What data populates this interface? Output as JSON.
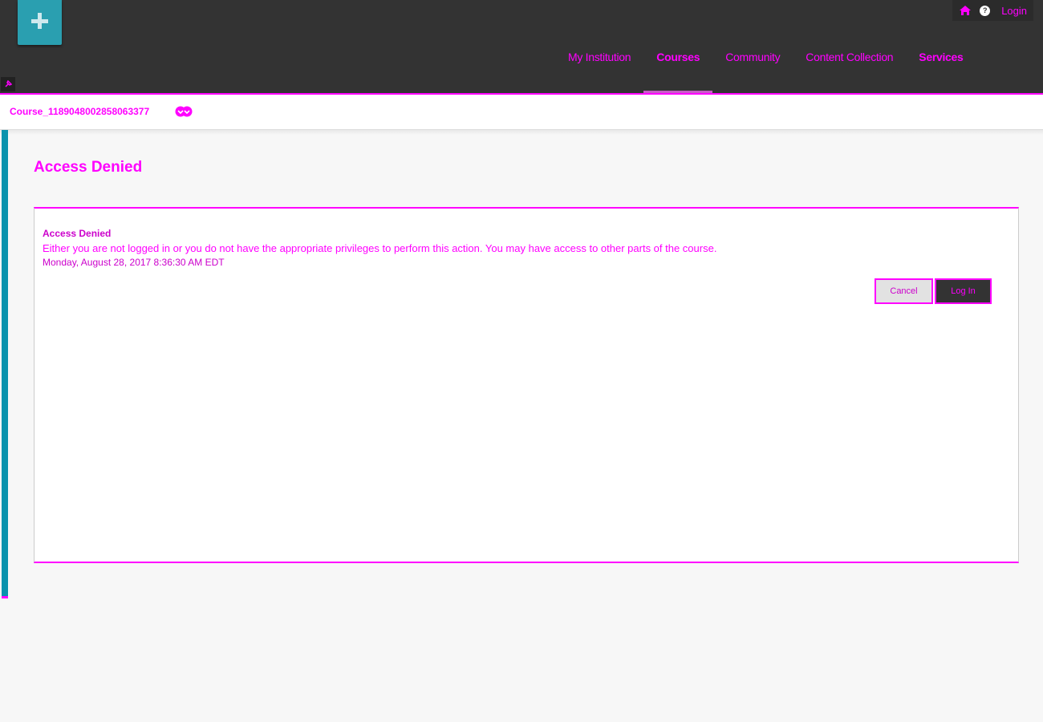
{
  "header": {
    "logo_icon": "plus-icon",
    "utility": {
      "home_icon": "home-icon",
      "help_icon": "help-icon",
      "help_glyph": "?",
      "login_label": "Login"
    },
    "nav": [
      {
        "label": "My Institution",
        "active": false
      },
      {
        "label": "Courses",
        "active": true
      },
      {
        "label": "Community",
        "active": false
      },
      {
        "label": "Content Collection",
        "active": false
      },
      {
        "label": "Services",
        "active": false
      }
    ],
    "pin_icon": "pin-icon"
  },
  "breadcrumb": {
    "course_id": "Course_1189048002858063377",
    "chevron_icon": "chevron-down-icon"
  },
  "page": {
    "title": "Access Denied"
  },
  "error": {
    "title": "Access Denied",
    "message": "Either you are not logged in or you do not have the appropriate privileges to perform this action. You may have access to other parts of the course.",
    "timestamp": "Monday, August 28, 2017 8:36:30 AM EDT"
  },
  "buttons": {
    "cancel_label": "Cancel",
    "login_label": "Log In"
  },
  "colors": {
    "header_bg": "#333333",
    "accent_magenta": "#ff00ff",
    "left_accent": "#0a93ad",
    "logo_teal": "#2a9fb0"
  }
}
